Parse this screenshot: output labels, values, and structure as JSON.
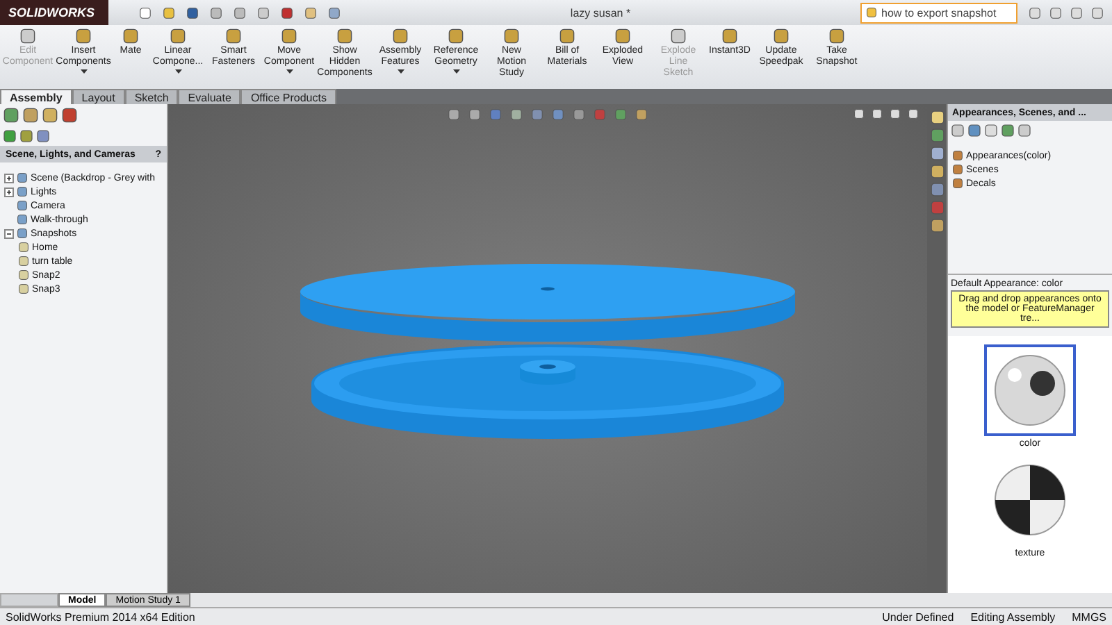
{
  "app": {
    "logo": "SOLIDWORKS",
    "title": "lazy susan *",
    "search": {
      "value": "how to export snapshot"
    }
  },
  "ribbon": [
    {
      "label": "Edit Component",
      "disabled": true,
      "dropdown": false
    },
    {
      "label": "Insert Components",
      "disabled": false,
      "dropdown": true
    },
    {
      "label": "Mate",
      "disabled": false,
      "dropdown": false
    },
    {
      "label": "Linear Compone...",
      "disabled": false,
      "dropdown": true
    },
    {
      "label": "Smart Fasteners",
      "disabled": false,
      "dropdown": false
    },
    {
      "label": "Move Component",
      "disabled": false,
      "dropdown": true
    },
    {
      "label": "Show Hidden Components",
      "disabled": false,
      "dropdown": false
    },
    {
      "label": "Assembly Features",
      "disabled": false,
      "dropdown": true
    },
    {
      "label": "Reference Geometry",
      "disabled": false,
      "dropdown": true
    },
    {
      "label": "New Motion Study",
      "disabled": false,
      "dropdown": false
    },
    {
      "label": "Bill of Materials",
      "disabled": false,
      "dropdown": false
    },
    {
      "label": "Exploded View",
      "disabled": false,
      "dropdown": false
    },
    {
      "label": "Explode Line Sketch",
      "disabled": true,
      "dropdown": false
    },
    {
      "label": "Instant3D",
      "disabled": false,
      "dropdown": false
    },
    {
      "label": "Update Speedpak",
      "disabled": false,
      "dropdown": false
    },
    {
      "label": "Take Snapshot",
      "disabled": false,
      "dropdown": false
    }
  ],
  "tabs": [
    {
      "label": "Assembly",
      "selected": true
    },
    {
      "label": "Layout",
      "selected": false
    },
    {
      "label": "Sketch",
      "selected": false
    },
    {
      "label": "Evaluate",
      "selected": false
    },
    {
      "label": "Office Products",
      "selected": false
    }
  ],
  "left_panel": {
    "title": "Scene, Lights, and Cameras",
    "help": "?",
    "tree": [
      {
        "label": "Scene (Backdrop - Grey with",
        "expanded": false
      },
      {
        "label": "Lights",
        "expanded": false
      },
      {
        "label": "Camera"
      },
      {
        "label": "Walk-through"
      },
      {
        "label": "Snapshots",
        "expanded": true,
        "children": [
          {
            "label": "Home"
          },
          {
            "label": "turn table"
          },
          {
            "label": "Snap2"
          },
          {
            "label": "Snap3"
          }
        ]
      }
    ]
  },
  "right_panel": {
    "title": "Appearances, Scenes, and ...",
    "tree": [
      {
        "label": "Appearances(color)"
      },
      {
        "label": "Scenes"
      },
      {
        "label": "Decals"
      }
    ],
    "default_label": "Default Appearance: color",
    "tooltip": "Drag and drop appearances onto the model or FeatureManager tre...",
    "swatches": [
      {
        "label": "color",
        "selected": true,
        "kind": "gloss"
      },
      {
        "label": "texture",
        "selected": false,
        "kind": "checker"
      }
    ]
  },
  "bottom_tabs": [
    {
      "label": "Model",
      "selected": true
    },
    {
      "label": "Motion Study 1",
      "selected": false
    }
  ],
  "status_bar": {
    "edition": "SolidWorks Premium 2014 x64 Edition",
    "state": "Under Defined",
    "mode": "Editing Assembly",
    "units": "MMGS"
  }
}
